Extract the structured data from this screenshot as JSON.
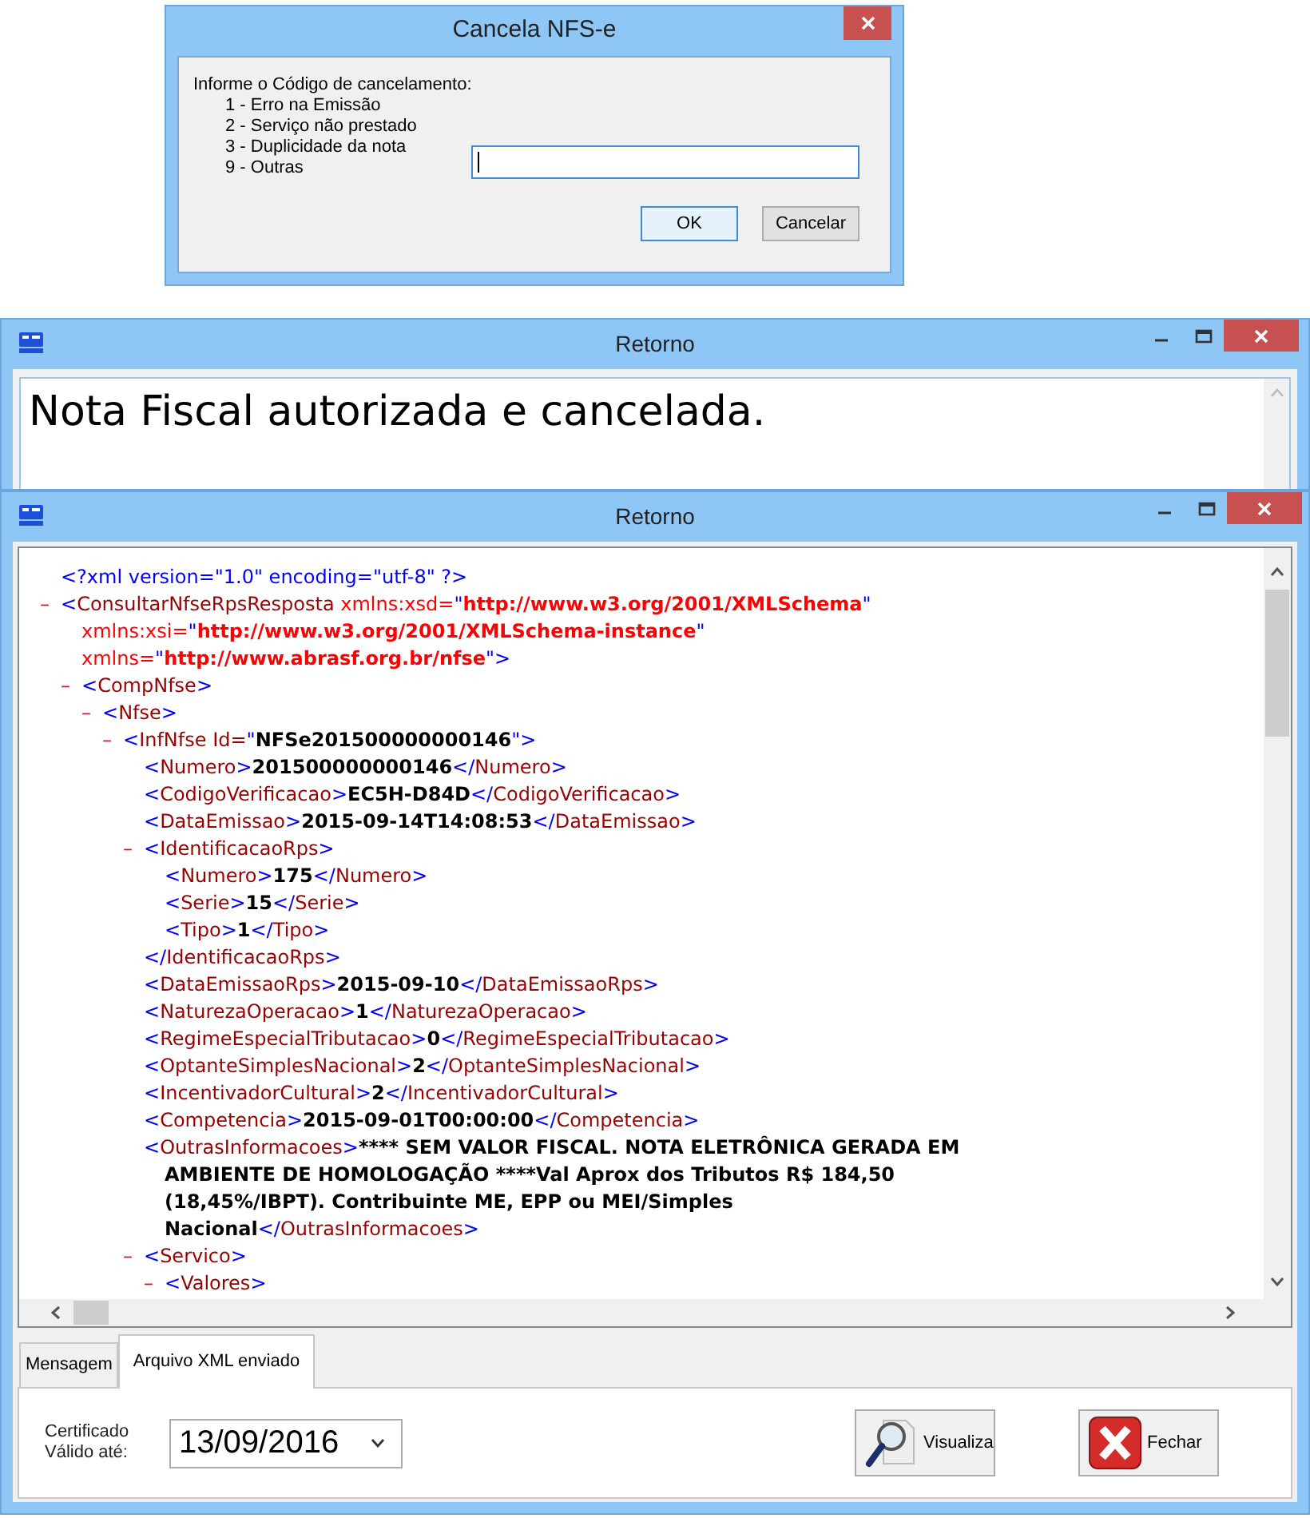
{
  "dialog": {
    "title": "Cancela NFS-e",
    "prompt": "Informe o Código de cancelamento:",
    "options": [
      "1 - Erro na Emissão",
      "2 - Serviço não prestado",
      "3 - Duplicidade da nota",
      "9 - Outras"
    ],
    "buttons": [
      {
        "label": "OK",
        "default": true
      },
      {
        "label": "Cancelar",
        "default": false
      }
    ]
  },
  "message_window": {
    "title": "Retorno",
    "message": "Nota Fiscal autorizada e cancelada."
  },
  "xml_window": {
    "title": "Retorno",
    "xml": [
      {
        "parts": [
          {
            "kind": "p",
            "text": "<?xml version=\"1.0\" encoding=\"utf-8\" ?>"
          }
        ]
      },
      {
        "toggle": "–",
        "parts": [
          {
            "kind": "p",
            "text": "<"
          },
          {
            "kind": "tag",
            "text": "ConsultarNfseRpsResposta"
          },
          {
            "kind": "attr",
            "text": " xmlns:xsd="
          },
          {
            "kind": "p",
            "text": "\""
          },
          {
            "kind": "value",
            "text": "http://www.w3.org/2001/XMLSchema"
          },
          {
            "kind": "p",
            "text": "\""
          },
          {
            "kind": "br"
          },
          {
            "kind": "attr",
            "text": "xmlns:xsi="
          },
          {
            "kind": "p",
            "text": "\""
          },
          {
            "kind": "value",
            "text": "http://www.w3.org/2001/XMLSchema-instance"
          },
          {
            "kind": "p",
            "text": "\""
          },
          {
            "kind": "br"
          },
          {
            "kind": "attr",
            "text": "xmlns="
          },
          {
            "kind": "p",
            "text": "\""
          },
          {
            "kind": "value",
            "text": "http://www.abrasf.org.br/nfse"
          },
          {
            "kind": "p",
            "text": "\">"
          }
        ],
        "children": [
          {
            "toggle": "–",
            "parts": [
              {
                "kind": "p",
                "text": "<"
              },
              {
                "kind": "tag",
                "text": "CompNfse"
              },
              {
                "kind": "p",
                "text": ">"
              }
            ],
            "children": [
              {
                "toggle": "–",
                "parts": [
                  {
                    "kind": "p",
                    "text": "<"
                  },
                  {
                    "kind": "tag",
                    "text": "Nfse"
                  },
                  {
                    "kind": "p",
                    "text": ">"
                  }
                ],
                "children": [
                  {
                    "toggle": "–",
                    "parts": [
                      {
                        "kind": "p",
                        "text": "<"
                      },
                      {
                        "kind": "tag",
                        "text": "InfNfse Id="
                      },
                      {
                        "kind": "p",
                        "text": "\""
                      },
                      {
                        "kind": "text",
                        "text": "NFSe201500000000146"
                      },
                      {
                        "kind": "p",
                        "text": "\">"
                      }
                    ],
                    "children": [
                      {
                        "parts": [
                          {
                            "kind": "p",
                            "text": "<"
                          },
                          {
                            "kind": "tag",
                            "text": "Numero"
                          },
                          {
                            "kind": "p",
                            "text": ">"
                          },
                          {
                            "kind": "text",
                            "text": "201500000000146"
                          },
                          {
                            "kind": "p",
                            "text": "</"
                          },
                          {
                            "kind": "tag",
                            "text": "Numero"
                          },
                          {
                            "kind": "p",
                            "text": ">"
                          }
                        ]
                      },
                      {
                        "parts": [
                          {
                            "kind": "p",
                            "text": "<"
                          },
                          {
                            "kind": "tag",
                            "text": "CodigoVerificacao"
                          },
                          {
                            "kind": "p",
                            "text": ">"
                          },
                          {
                            "kind": "text",
                            "text": "EC5H-D84D"
                          },
                          {
                            "kind": "p",
                            "text": "</"
                          },
                          {
                            "kind": "tag",
                            "text": "CodigoVerificacao"
                          },
                          {
                            "kind": "p",
                            "text": ">"
                          }
                        ]
                      },
                      {
                        "parts": [
                          {
                            "kind": "p",
                            "text": "<"
                          },
                          {
                            "kind": "tag",
                            "text": "DataEmissao"
                          },
                          {
                            "kind": "p",
                            "text": ">"
                          },
                          {
                            "kind": "text",
                            "text": "2015-09-14T14:08:53"
                          },
                          {
                            "kind": "p",
                            "text": "</"
                          },
                          {
                            "kind": "tag",
                            "text": "DataEmissao"
                          },
                          {
                            "kind": "p",
                            "text": ">"
                          }
                        ]
                      },
                      {
                        "toggle": "–",
                        "parts": [
                          {
                            "kind": "p",
                            "text": "<"
                          },
                          {
                            "kind": "tag",
                            "text": "IdentificacaoRps"
                          },
                          {
                            "kind": "p",
                            "text": ">"
                          }
                        ],
                        "children": [
                          {
                            "parts": [
                              {
                                "kind": "p",
                                "text": "<"
                              },
                              {
                                "kind": "tag",
                                "text": "Numero"
                              },
                              {
                                "kind": "p",
                                "text": ">"
                              },
                              {
                                "kind": "text",
                                "text": "175"
                              },
                              {
                                "kind": "p",
                                "text": "</"
                              },
                              {
                                "kind": "tag",
                                "text": "Numero"
                              },
                              {
                                "kind": "p",
                                "text": ">"
                              }
                            ]
                          },
                          {
                            "parts": [
                              {
                                "kind": "p",
                                "text": "<"
                              },
                              {
                                "kind": "tag",
                                "text": "Serie"
                              },
                              {
                                "kind": "p",
                                "text": ">"
                              },
                              {
                                "kind": "text",
                                "text": "15"
                              },
                              {
                                "kind": "p",
                                "text": "</"
                              },
                              {
                                "kind": "tag",
                                "text": "Serie"
                              },
                              {
                                "kind": "p",
                                "text": ">"
                              }
                            ]
                          },
                          {
                            "parts": [
                              {
                                "kind": "p",
                                "text": "<"
                              },
                              {
                                "kind": "tag",
                                "text": "Tipo"
                              },
                              {
                                "kind": "p",
                                "text": ">"
                              },
                              {
                                "kind": "text",
                                "text": "1"
                              },
                              {
                                "kind": "p",
                                "text": "</"
                              },
                              {
                                "kind": "tag",
                                "text": "Tipo"
                              },
                              {
                                "kind": "p",
                                "text": ">"
                              }
                            ]
                          }
                        ],
                        "close": [
                          {
                            "kind": "p",
                            "text": "</"
                          },
                          {
                            "kind": "tag",
                            "text": "IdentificacaoRps"
                          },
                          {
                            "kind": "p",
                            "text": ">"
                          }
                        ]
                      },
                      {
                        "parts": [
                          {
                            "kind": "p",
                            "text": "<"
                          },
                          {
                            "kind": "tag",
                            "text": "DataEmissaoRps"
                          },
                          {
                            "kind": "p",
                            "text": ">"
                          },
                          {
                            "kind": "text",
                            "text": "2015-09-10"
                          },
                          {
                            "kind": "p",
                            "text": "</"
                          },
                          {
                            "kind": "tag",
                            "text": "DataEmissaoRps"
                          },
                          {
                            "kind": "p",
                            "text": ">"
                          }
                        ]
                      },
                      {
                        "parts": [
                          {
                            "kind": "p",
                            "text": "<"
                          },
                          {
                            "kind": "tag",
                            "text": "NaturezaOperacao"
                          },
                          {
                            "kind": "p",
                            "text": ">"
                          },
                          {
                            "kind": "text",
                            "text": "1"
                          },
                          {
                            "kind": "p",
                            "text": "</"
                          },
                          {
                            "kind": "tag",
                            "text": "NaturezaOperacao"
                          },
                          {
                            "kind": "p",
                            "text": ">"
                          }
                        ]
                      },
                      {
                        "parts": [
                          {
                            "kind": "p",
                            "text": "<"
                          },
                          {
                            "kind": "tag",
                            "text": "RegimeEspecialTributacao"
                          },
                          {
                            "kind": "p",
                            "text": ">"
                          },
                          {
                            "kind": "text",
                            "text": "0"
                          },
                          {
                            "kind": "p",
                            "text": "</"
                          },
                          {
                            "kind": "tag",
                            "text": "RegimeEspecialTributacao"
                          },
                          {
                            "kind": "p",
                            "text": ">"
                          }
                        ]
                      },
                      {
                        "parts": [
                          {
                            "kind": "p",
                            "text": "<"
                          },
                          {
                            "kind": "tag",
                            "text": "OptanteSimplesNacional"
                          },
                          {
                            "kind": "p",
                            "text": ">"
                          },
                          {
                            "kind": "text",
                            "text": "2"
                          },
                          {
                            "kind": "p",
                            "text": "</"
                          },
                          {
                            "kind": "tag",
                            "text": "OptanteSimplesNacional"
                          },
                          {
                            "kind": "p",
                            "text": ">"
                          }
                        ]
                      },
                      {
                        "parts": [
                          {
                            "kind": "p",
                            "text": "<"
                          },
                          {
                            "kind": "tag",
                            "text": "IncentivadorCultural"
                          },
                          {
                            "kind": "p",
                            "text": ">"
                          },
                          {
                            "kind": "text",
                            "text": "2"
                          },
                          {
                            "kind": "p",
                            "text": "</"
                          },
                          {
                            "kind": "tag",
                            "text": "IncentivadorCultural"
                          },
                          {
                            "kind": "p",
                            "text": ">"
                          }
                        ]
                      },
                      {
                        "parts": [
                          {
                            "kind": "p",
                            "text": "<"
                          },
                          {
                            "kind": "tag",
                            "text": "Competencia"
                          },
                          {
                            "kind": "p",
                            "text": ">"
                          },
                          {
                            "kind": "text",
                            "text": "2015-09-01T00:00:00"
                          },
                          {
                            "kind": "p",
                            "text": "</"
                          },
                          {
                            "kind": "tag",
                            "text": "Competencia"
                          },
                          {
                            "kind": "p",
                            "text": ">"
                          }
                        ]
                      },
                      {
                        "parts": [
                          {
                            "kind": "p",
                            "text": "<"
                          },
                          {
                            "kind": "tag",
                            "text": "OutrasInformacoes"
                          },
                          {
                            "kind": "p",
                            "text": ">"
                          },
                          {
                            "kind": "text",
                            "text": "**** SEM VALOR FISCAL. NOTA ELETRÔNICA GERADA EM AMBIENTE DE HOMOLOGAÇÃO ****Val Aprox dos Tributos R$ 184,50 (18,45%/IBPT). Contribuinte ME, EPP ou MEI/Simples Nacional"
                          },
                          {
                            "kind": "p",
                            "text": "</"
                          },
                          {
                            "kind": "tag",
                            "text": "OutrasInformacoes"
                          },
                          {
                            "kind": "p",
                            "text": ">"
                          }
                        ]
                      },
                      {
                        "toggle": "–",
                        "parts": [
                          {
                            "kind": "p",
                            "text": "<"
                          },
                          {
                            "kind": "tag",
                            "text": "Servico"
                          },
                          {
                            "kind": "p",
                            "text": ">"
                          }
                        ],
                        "children": [
                          {
                            "toggle": "–",
                            "parts": [
                              {
                                "kind": "p",
                                "text": "<"
                              },
                              {
                                "kind": "tag",
                                "text": "Valores"
                              },
                              {
                                "kind": "p",
                                "text": ">"
                              }
                            ]
                          }
                        ]
                      }
                    ]
                  }
                ]
              }
            ]
          }
        ]
      }
    ],
    "tabs": [
      {
        "label": "Mensagem",
        "selected": false
      },
      {
        "label": "Arquivo XML enviado",
        "selected": true
      }
    ],
    "certificate_label": [
      "Certificado",
      "Válido até:"
    ],
    "valid_until": "13/09/2016",
    "buttons": [
      {
        "label": "Visualiza",
        "kind": "view"
      },
      {
        "label": "Fechar",
        "kind": "close"
      }
    ]
  }
}
